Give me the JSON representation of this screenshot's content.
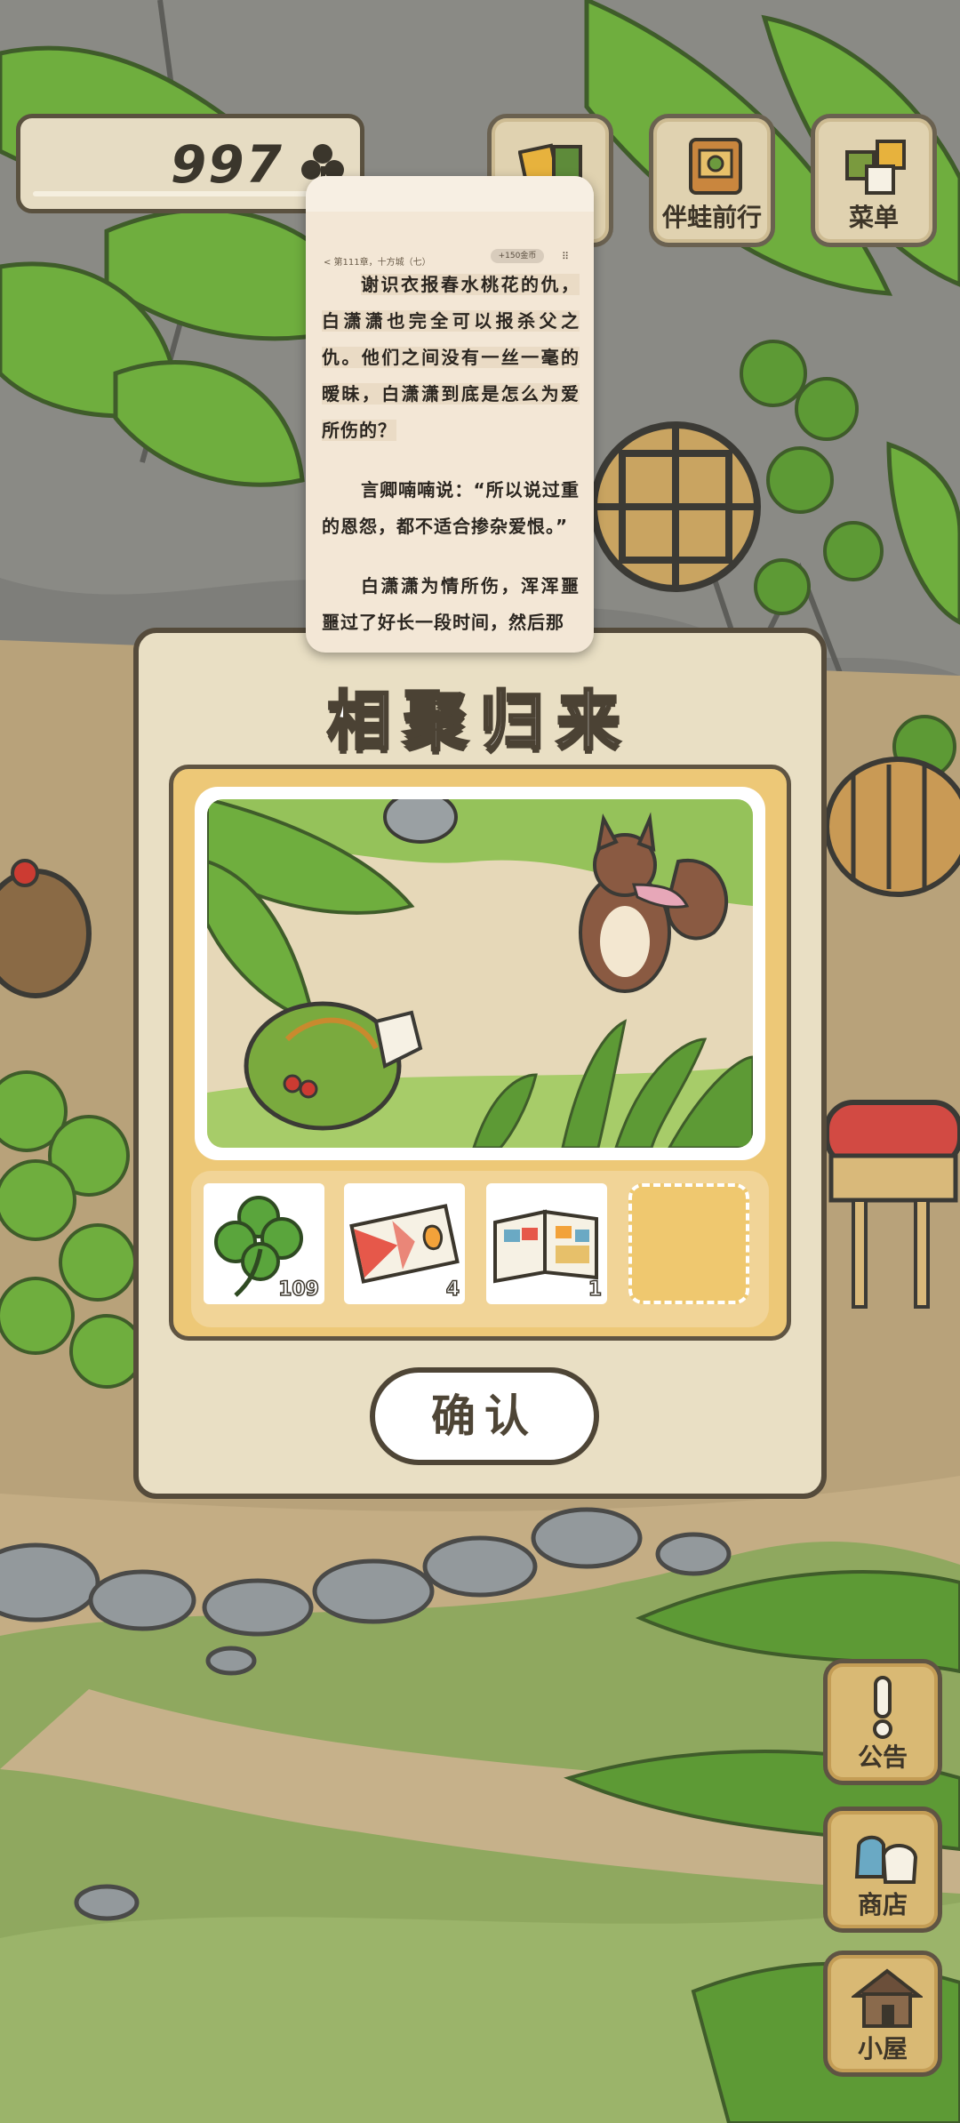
{
  "hud": {
    "clover_count": "997",
    "top_buttons": [
      {
        "label": "伴蛙前行"
      },
      {
        "label": "菜单"
      }
    ],
    "side_buttons": [
      {
        "label": "公告"
      },
      {
        "label": "商店"
      },
      {
        "label": "小屋"
      }
    ]
  },
  "reader": {
    "chapter": "< 第111章，十方城（七）",
    "badge": "+150金币",
    "paragraphs": [
      "谢识衣报春水桃花的仇，白潇潇也完全可以报杀父之仇。他们之间没有一丝一毫的暧昧，白潇潇到底是怎么为爱所伤的？",
      "言卿喃喃说：“所以说过重的恩怨，都不适合掺杂爱恨。”",
      "白潇潇为情所伤，浑浑噩噩过了好长一段时间，然后那"
    ]
  },
  "modal": {
    "title": "相聚归来",
    "items": [
      {
        "name": "clover",
        "count": "109"
      },
      {
        "name": "ticket",
        "count": "4"
      },
      {
        "name": "pamphlet",
        "count": "1"
      },
      {
        "name": "empty",
        "count": ""
      }
    ],
    "confirm_label": "确认"
  },
  "colors": {
    "modal_bg": "#e9dfc4",
    "inner_panel": "#edc877",
    "outline": "#554b3b"
  }
}
